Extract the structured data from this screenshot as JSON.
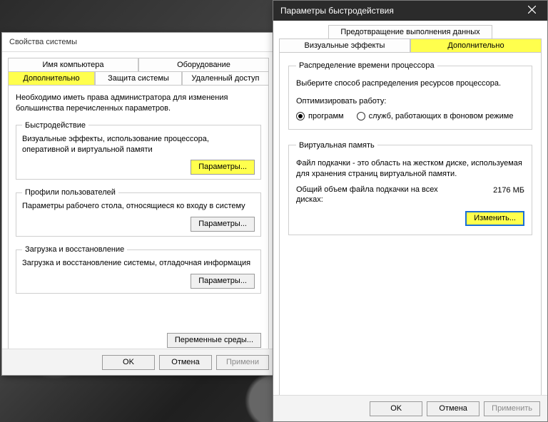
{
  "sys": {
    "title": "Свойства системы",
    "tabs_row1": [
      "Имя компьютера",
      "Оборудование"
    ],
    "tabs_row2": [
      "Дополнительно",
      "Защита системы",
      "Удаленный доступ"
    ],
    "active_tab": "Дополнительно",
    "admin_note": "Необходимо иметь права администратора для изменения большинства перечисленных параметров.",
    "group_performance": {
      "legend": "Быстродействие",
      "desc": "Визуальные эффекты, использование процессора, оперативной и виртуальной памяти",
      "button": "Параметры..."
    },
    "group_profiles": {
      "legend": "Профили пользователей",
      "desc": "Параметры рабочего стола, относящиеся ко входу в систему",
      "button": "Параметры..."
    },
    "group_startup": {
      "legend": "Загрузка и восстановление",
      "desc": "Загрузка и восстановление системы, отладочная информация",
      "button": "Параметры..."
    },
    "env_vars_button": "Переменные среды...",
    "footer": {
      "ok": "OK",
      "cancel": "Отмена",
      "apply": "Примени"
    }
  },
  "perf": {
    "title": "Параметры быстродействия",
    "tab_dep": "Предотвращение выполнения данных",
    "tab_visual": "Визуальные эффекты",
    "tab_adv": "Дополнительно",
    "active_tab": "Дополнительно",
    "cpu": {
      "legend": "Распределение времени процессора",
      "desc": "Выберите способ распределения ресурсов процессора.",
      "opt_label": "Оптимизировать работу:",
      "radio_programs": "программ",
      "radio_services": "служб, работающих в фоновом режиме",
      "selected": "programs"
    },
    "vm": {
      "legend": "Виртуальная память",
      "desc": "Файл подкачки - это область на жестком диске, используемая для хранения страниц виртуальной памяти.",
      "total_label": "Общий объем файла подкачки на всех дисках:",
      "total_value": "2176 МБ",
      "change": "Изменить..."
    },
    "footer": {
      "ok": "OK",
      "cancel": "Отмена",
      "apply": "Применить"
    }
  }
}
